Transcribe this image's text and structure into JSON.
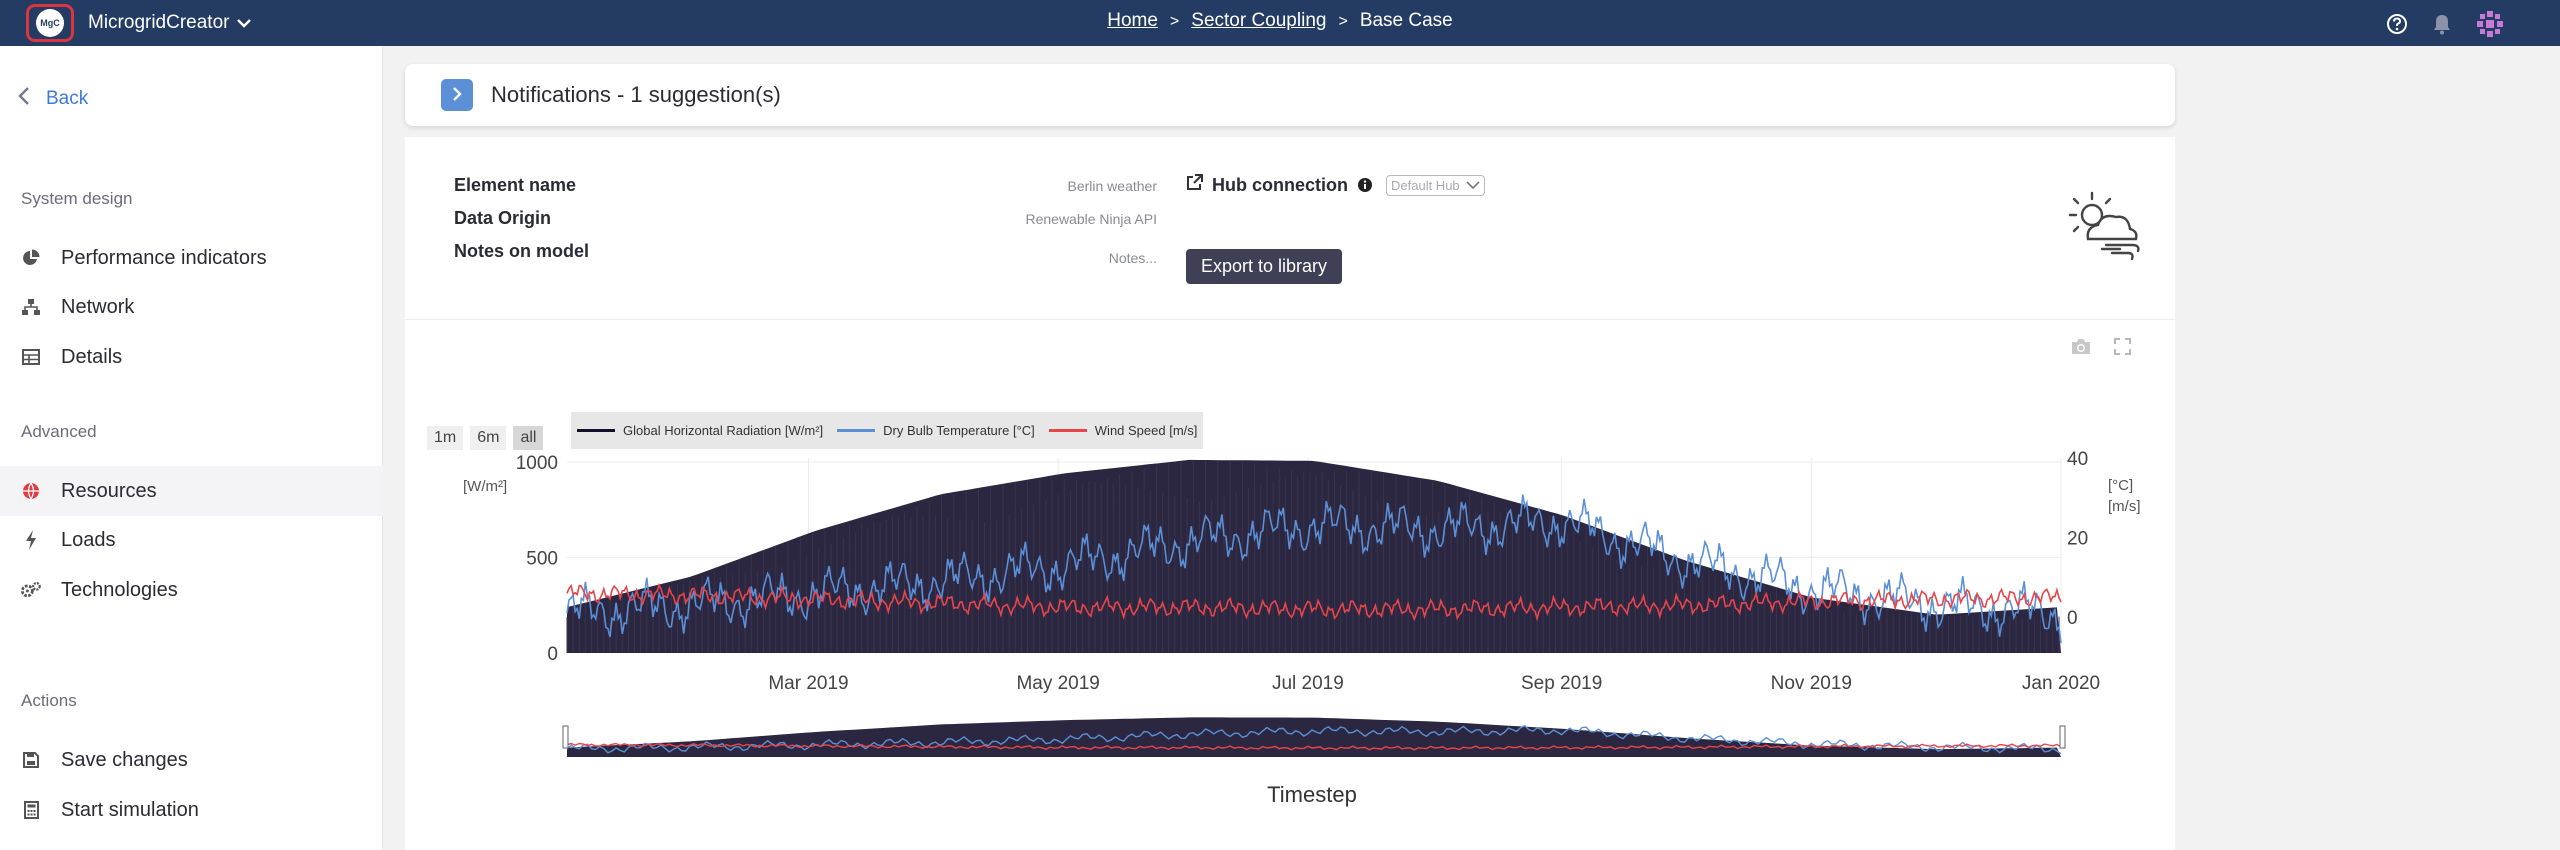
{
  "app": {
    "name": "MicrogridCreator",
    "logo_text": "MgC"
  },
  "breadcrumb": {
    "home": "Home",
    "sector": "Sector Coupling",
    "current": "Base Case",
    "separator": ">"
  },
  "sidebar": {
    "back": "Back",
    "system_design_title": "System design",
    "performance": "Performance indicators",
    "network": "Network",
    "details": "Details",
    "advanced_title": "Advanced",
    "resources": "Resources",
    "loads": "Loads",
    "technologies": "Technologies",
    "actions_title": "Actions",
    "save": "Save changes",
    "simulate": "Start simulation"
  },
  "notifications": {
    "title": "Notifications - 1 suggestion(s)"
  },
  "element": {
    "name_label": "Element name",
    "name_value": "Berlin weather",
    "origin_label": "Data Origin",
    "origin_value": "Renewable Ninja API",
    "notes_label": "Notes on model",
    "notes_value": "Notes...",
    "hub_label": "Hub connection",
    "hub_value": "Default Hub",
    "export_label": "Export to library"
  },
  "range_buttons": [
    "1m",
    "6m",
    "all"
  ],
  "colors": {
    "radiation": "#14102b",
    "temperature": "#5b8fd6",
    "wind": "#e8454a",
    "topbar": "#243b63",
    "accent": "#3e7bd6"
  },
  "chart_data": {
    "type": "line",
    "x_start": "2019-01-01",
    "x_end": "2020-01-01",
    "x_ticks": [
      "Mar 2019",
      "May 2019",
      "Jul 2019",
      "Sep 2019",
      "Nov 2019",
      "Jan 2020"
    ],
    "xlabel": "Timestep",
    "y_left": {
      "label": "[W/m²]",
      "ticks": [
        "0",
        "500",
        "1000"
      ],
      "range": [
        0,
        1020
      ]
    },
    "y_right": {
      "label_line1": "[°C]",
      "label_line2": "[m/s]",
      "ticks": [
        "0",
        "20",
        "40"
      ],
      "range": [
        -9,
        40
      ]
    },
    "series": [
      {
        "name": "Global Horizontal Radiation [W/m²]",
        "axis": "left",
        "monthly_peak_values": [
          240,
          400,
          640,
          830,
          940,
          1010,
          1005,
          900,
          720,
          480,
          290,
          200,
          240
        ]
      },
      {
        "name": "Dry Bulb Temperature [°C]",
        "axis": "right",
        "monthly_values": [
          1,
          3,
          6,
          9,
          13,
          19,
          23,
          22,
          24,
          14,
          7,
          3,
          1
        ]
      },
      {
        "name": "Wind Speed [m/s]",
        "axis": "right",
        "monthly_values": [
          6,
          5.5,
          4.5,
          3.5,
          2.5,
          2.5,
          2,
          2,
          2.5,
          3,
          4,
          4.5,
          5
        ]
      }
    ]
  }
}
